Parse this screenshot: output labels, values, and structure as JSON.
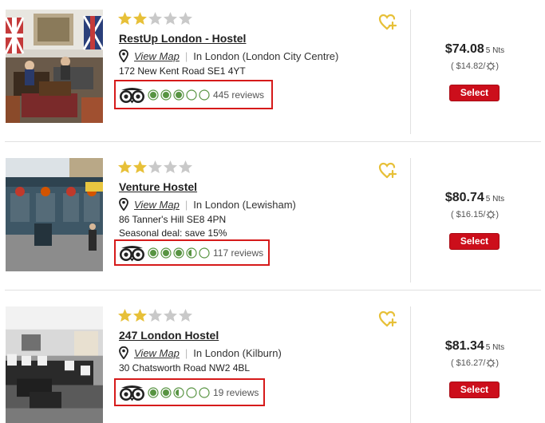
{
  "colors": {
    "star_filled": "#e7c038",
    "star_empty": "#c9c9c9",
    "heart": "#e7c038",
    "bubble_green": "#589442",
    "highlight_border": "#d61a1a",
    "select_button": "#cc0e1b"
  },
  "icons": {
    "location": "map-pin-icon",
    "favorite": "heart-plus-icon",
    "tripadvisor": "tripadvisor-owl-icon",
    "night": "moon-sun-icon"
  },
  "listings": [
    {
      "star_rating": 2,
      "star_max": 5,
      "name": "RestUp London - Hostel",
      "view_map_label": "View Map",
      "location": "In London (London City Centre)",
      "address": "172 New Kent Road SE1 4YT",
      "deal": "",
      "ta_rating": 3,
      "ta_max": 5,
      "reviews": "445 reviews",
      "price": "$74.08",
      "nights": "5 Nts",
      "per_night": "( $14.82/",
      "per_night_close": ")",
      "select_label": "Select"
    },
    {
      "star_rating": 2,
      "star_max": 5,
      "name": "Venture Hostel",
      "view_map_label": "View Map",
      "location": "In London (Lewisham)",
      "address": "86 Tanner's Hill SE8 4PN",
      "deal": "Seasonal deal: save 15%",
      "ta_rating": 3.5,
      "ta_max": 5,
      "reviews": "117 reviews",
      "price": "$80.74",
      "nights": "5 Nts",
      "per_night": "( $16.15/",
      "per_night_close": ")",
      "select_label": "Select"
    },
    {
      "star_rating": 2,
      "star_max": 5,
      "name": "247 London Hostel",
      "view_map_label": "View Map",
      "location": "In London (Kilburn)",
      "address": "30 Chatsworth Road NW2 4BL",
      "deal": "",
      "ta_rating": 2.5,
      "ta_max": 5,
      "reviews": "19 reviews",
      "price": "$81.34",
      "nights": "5 Nts",
      "per_night": "( $16.27/",
      "per_night_close": ")",
      "select_label": "Select"
    }
  ]
}
